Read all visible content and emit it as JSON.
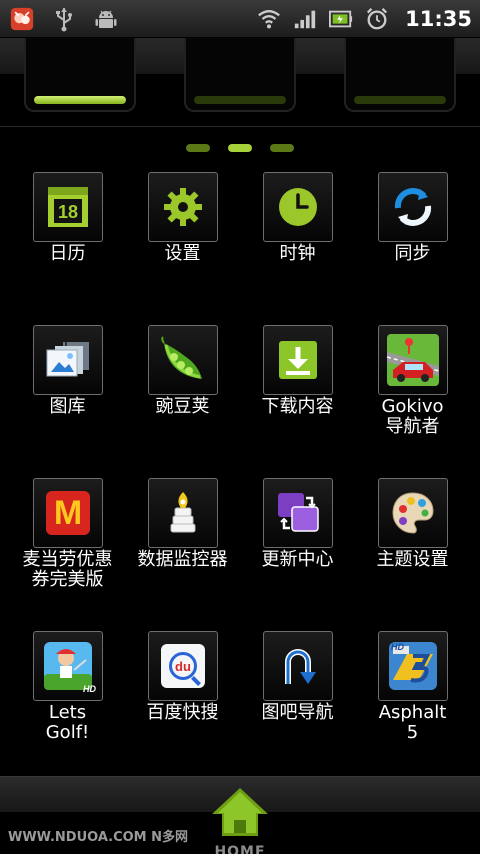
{
  "status_bar": {
    "time": "11:35",
    "icons": [
      "app-notification-icon",
      "usb-icon",
      "android-debug-icon",
      "wifi-icon",
      "signal-icon",
      "battery-icon",
      "alarm-icon"
    ]
  },
  "tabs": [
    {
      "name": "tab-1",
      "active": true
    },
    {
      "name": "tab-2",
      "active": false
    },
    {
      "name": "tab-3",
      "active": false
    }
  ],
  "pages": {
    "count": 3,
    "current": 2
  },
  "apps": [
    {
      "label": "日历",
      "icon": "calendar-icon",
      "calendar_day": "18"
    },
    {
      "label": "设置",
      "icon": "gear-icon"
    },
    {
      "label": "时钟",
      "icon": "clock-icon"
    },
    {
      "label": "同步",
      "icon": "sync-icon"
    },
    {
      "label": "图库",
      "icon": "gallery-icon"
    },
    {
      "label": "豌豆荚",
      "icon": "peapod-icon"
    },
    {
      "label": "下载内容",
      "icon": "download-icon"
    },
    {
      "label": "Gokivo\n导航者",
      "icon": "car-navigation-icon"
    },
    {
      "label": "麦当劳优惠\n券完美版",
      "icon": "mcdonalds-icon",
      "glyph": "M"
    },
    {
      "label": "数据监控器",
      "icon": "data-monitor-icon"
    },
    {
      "label": "更新中心",
      "icon": "update-center-icon"
    },
    {
      "label": "主题设置",
      "icon": "palette-icon"
    },
    {
      "label": "Lets\nGolf!",
      "icon": "golf-game-icon",
      "badge": "HD"
    },
    {
      "label": "百度快搜",
      "icon": "baidu-search-icon",
      "glyph": "du"
    },
    {
      "label": "图吧导航",
      "icon": "u-turn-nav-icon"
    },
    {
      "label": "Asphalt\n5",
      "icon": "asphalt-game-icon",
      "badge": "HD"
    }
  ],
  "dock": {
    "home_label": "HOME"
  },
  "watermark": "WWW.NDUOA.COM N多网",
  "colors": {
    "accent": "#a7d13a",
    "home": "#6e9e12"
  }
}
